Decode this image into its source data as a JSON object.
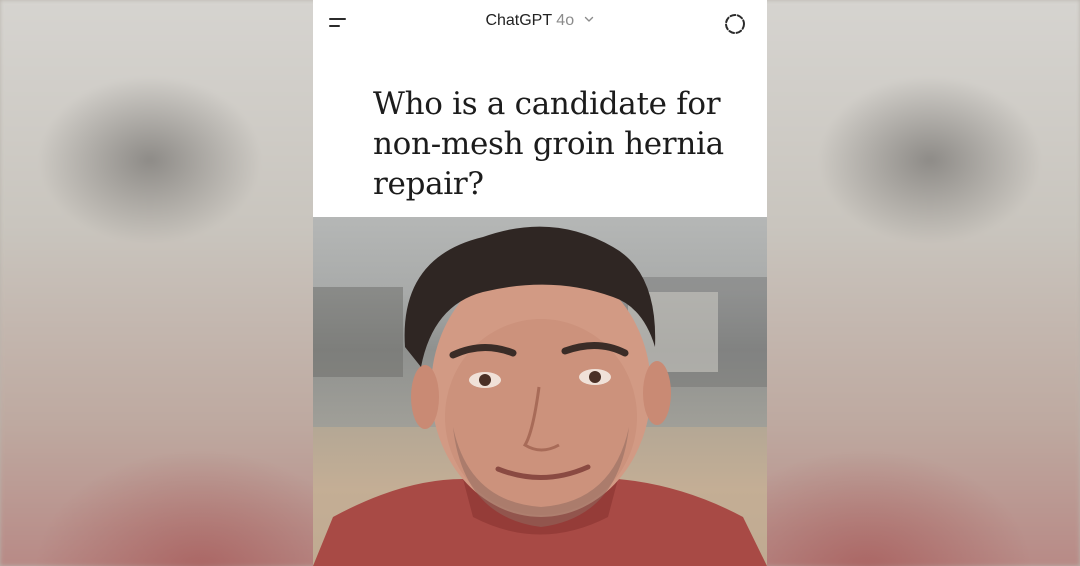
{
  "header": {
    "app_name": "ChatGPT",
    "model": "4o"
  },
  "icons": {
    "menu": "menu-icon",
    "model_dropdown": "chevron-down-icon",
    "new_chat": "new-chat-icon"
  },
  "conversation": {
    "question": "Who is a candidate for non-mesh groin hernia repair?"
  },
  "colors": {
    "header_text": "#222222",
    "model_text": "#8b8b8b",
    "question_text": "#1c1c1c"
  }
}
